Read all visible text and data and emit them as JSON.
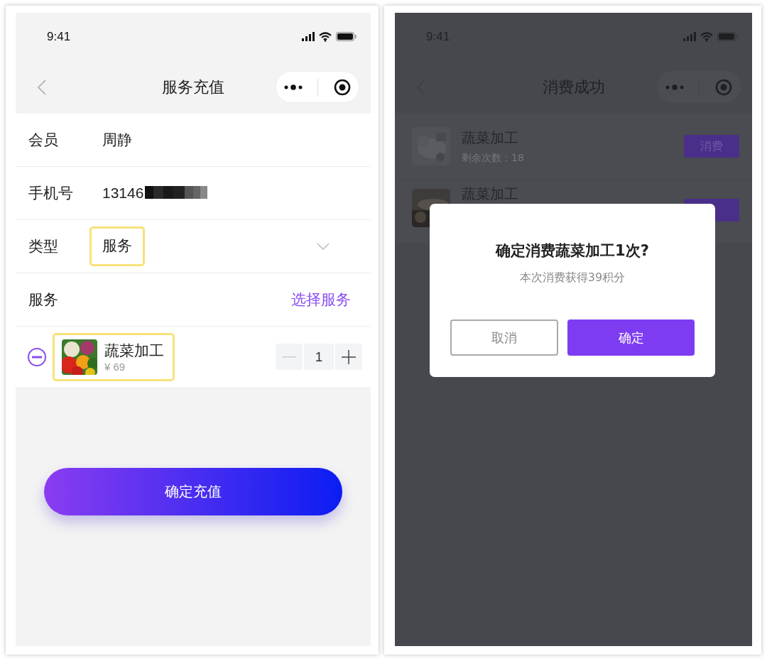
{
  "left": {
    "status_time": "9:41",
    "title": "服务充值",
    "rows": [
      {
        "kind": "text",
        "label": "会员",
        "value": "周静",
        "highlighted": false
      },
      {
        "kind": "masked",
        "label": "手机号",
        "value": "13146",
        "highlighted": false
      },
      {
        "kind": "select",
        "label": "类型",
        "value": "服务",
        "highlighted": true
      },
      {
        "kind": "link",
        "label": "服务",
        "value": "选择服务",
        "highlighted": false
      }
    ],
    "service_item": {
      "name": "蔬菜加工",
      "price": "¥ 69",
      "quantity": "1",
      "highlighted": true
    },
    "submit": "确定充值"
  },
  "right": {
    "status_time": "9:41",
    "title": "消费成功",
    "items": [
      {
        "name": "蔬菜加工",
        "remaining": "剩余次数：18",
        "button": "消费"
      },
      {
        "name": "蔬菜加工"
      }
    ],
    "dialog": {
      "title": "确定消费蔬菜加工1次?",
      "message": "本次消费获得39积分",
      "cancel": "取消",
      "confirm": "确定"
    }
  }
}
